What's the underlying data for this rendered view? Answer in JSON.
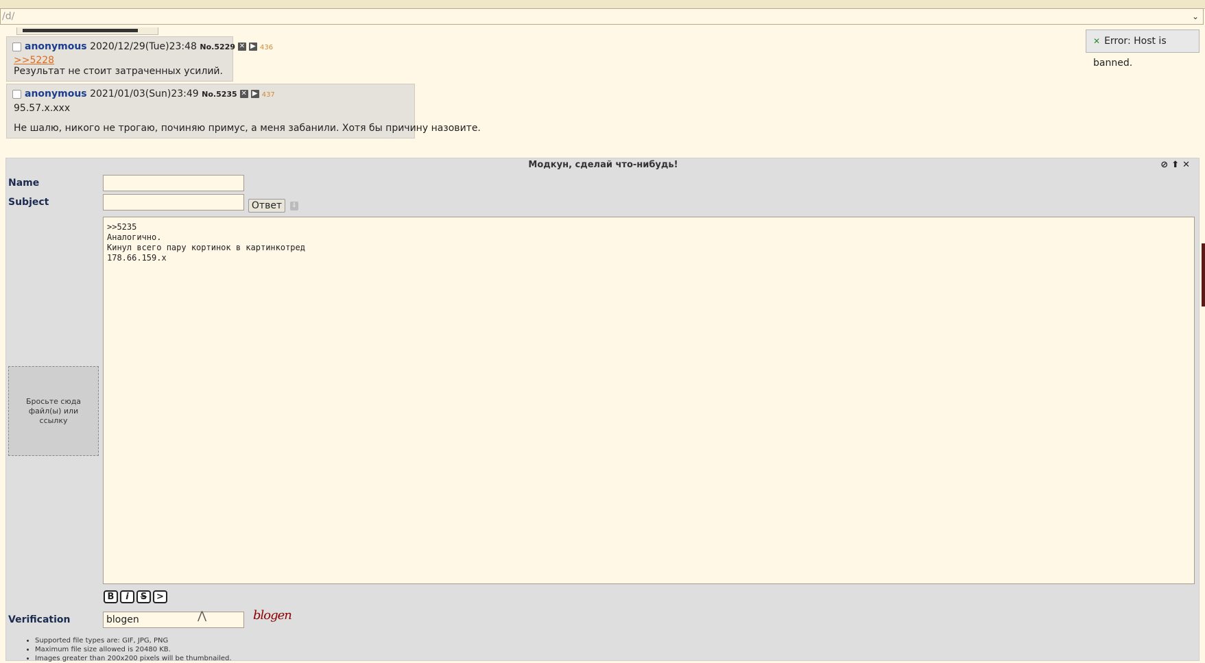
{
  "board_select": {
    "value": "/d/"
  },
  "notice": {
    "text": "Error: Host is banned."
  },
  "posts": [
    {
      "name": "anonymous",
      "date": "2020/12/29(Tue)23:48",
      "no": "No.5229",
      "count": "436",
      "quote": ">>5228",
      "lines": [
        "Результат не стоит затраченных усилий."
      ]
    },
    {
      "name": "anonymous",
      "date": "2021/01/03(Sun)23:49",
      "no": "No.5235",
      "count": "437",
      "lines": [
        "95.57.x.xxx",
        "Не шалю, никого не трогаю, починяю примус, а меня забанили. Хотя бы причину назовите."
      ]
    }
  ],
  "form": {
    "title": "Модкун, сделай что-нибудь!",
    "name_label": "Name",
    "subject_label": "Subject",
    "reply_button": "Ответ",
    "message": ">>5235\nАналогично.\nКинул всего пару кортинок в картинкотред\n178.66.159.x",
    "drop_zone": "Бросьте сюда файл(ы) или ссылку",
    "format_buttons": [
      "B",
      "i",
      "S",
      ">"
    ],
    "verification_label": "Verification",
    "verification_value": "blogen",
    "captcha_text": "blogen",
    "rules": [
      "Supported file types are: GIF, JPG, PNG",
      "Maximum file size allowed is 20480 KB.",
      "Images greater than 200x200 pixels will be thumbnailed."
    ]
  }
}
